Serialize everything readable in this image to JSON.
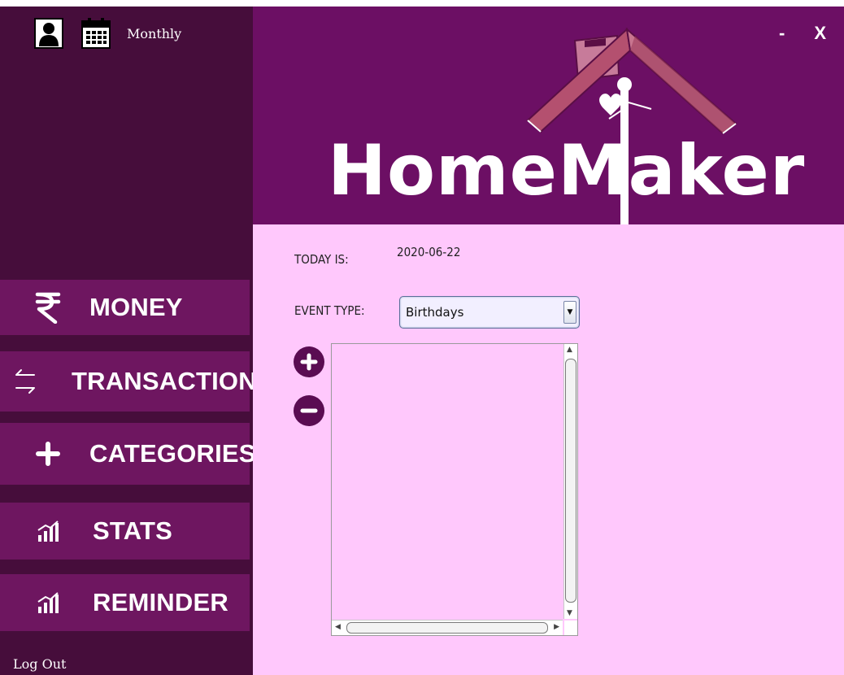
{
  "sidebar": {
    "view_mode": "Monthly",
    "nav": [
      {
        "label": "MONEY",
        "icon": "rupee-icon"
      },
      {
        "label": "TRANSACTIONS",
        "icon": "transfer-arrows-icon"
      },
      {
        "label": "CATEGORIES",
        "icon": "plus-icon"
      },
      {
        "label": "STATS",
        "icon": "bar-chart-icon"
      },
      {
        "label": "REMINDER",
        "icon": "bar-chart-icon"
      }
    ],
    "logout": "Log Out"
  },
  "header": {
    "logo_text": "HomeMaker",
    "minimize": "-",
    "close": "X"
  },
  "content": {
    "today_label": "TODAY IS:",
    "today_value": "2020-06-22",
    "event_type_label": "EVENT TYPE:",
    "event_type_selected": "Birthdays",
    "event_items": []
  },
  "colors": {
    "sidebar_bg": "#460d3b",
    "nav_bg": "#6e1660",
    "header_bg": "#6c0f64",
    "content_bg": "#ffc8fc",
    "button_bg": "#5a0c52"
  }
}
